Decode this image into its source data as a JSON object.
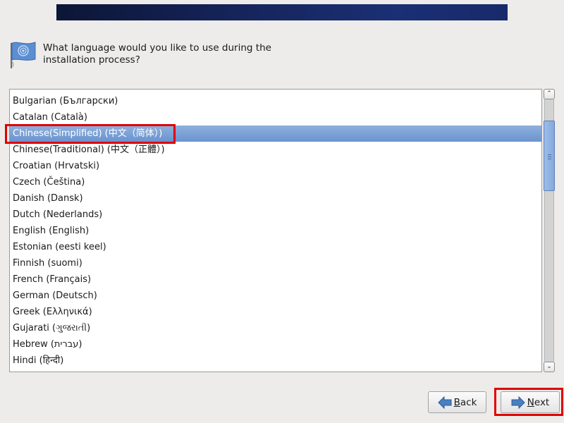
{
  "header": {
    "banner": "installer-banner"
  },
  "prompt": {
    "icon": "language-flag-icon",
    "text": "What language would you like to use during the installation process?"
  },
  "language_list": {
    "selected_index": 2,
    "items": [
      {
        "label": "Bulgarian (Български)"
      },
      {
        "label": "Catalan (Català)"
      },
      {
        "label": "Chinese(Simplified) (中文（简体）)"
      },
      {
        "label": "Chinese(Traditional) (中文（正體）)"
      },
      {
        "label": "Croatian (Hrvatski)"
      },
      {
        "label": "Czech (Čeština)"
      },
      {
        "label": "Danish (Dansk)"
      },
      {
        "label": "Dutch (Nederlands)"
      },
      {
        "label": "English (English)"
      },
      {
        "label": "Estonian (eesti keel)"
      },
      {
        "label": "Finnish (suomi)"
      },
      {
        "label": "French (Français)"
      },
      {
        "label": "German (Deutsch)"
      },
      {
        "label": "Greek (Ελληνικά)"
      },
      {
        "label": "Gujarati (ગુજરાતી)"
      },
      {
        "label": "Hebrew (עברית)"
      },
      {
        "label": "Hindi (हिन्दी)"
      }
    ],
    "scroll_position_fraction": 0.08,
    "visible_fraction": 0.27
  },
  "scrollbar": {
    "up_glyph": "⌃",
    "down_glyph": "⌄"
  },
  "buttons": {
    "back": {
      "mnemonic": "B",
      "rest": "ack",
      "icon": "back-arrow-icon"
    },
    "next": {
      "mnemonic": "N",
      "rest": "ext",
      "icon": "next-arrow-icon"
    }
  },
  "annotations": {
    "highlight_color": "#e00000",
    "highlighted": [
      "selected-language-row",
      "next-button"
    ]
  },
  "colors": {
    "selection": "#7a9fd6",
    "banner": "#15245a",
    "background": "#edeceb"
  }
}
